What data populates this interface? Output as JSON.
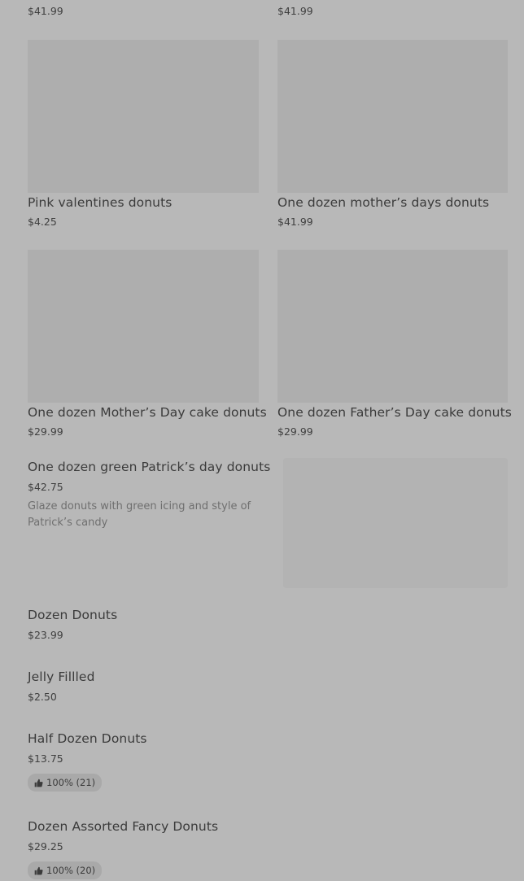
{
  "top_row": [
    {
      "price": "$41.99"
    },
    {
      "price": "$41.99"
    }
  ],
  "grid": [
    {
      "title": "Pink valentines donuts",
      "price": "$4.25"
    },
    {
      "title": "One dozen mother’s days donuts",
      "price": "$41.99"
    },
    {
      "title": "One dozen Mother’s Day cake donuts",
      "price": "$29.99"
    },
    {
      "title": "One dozen Father’s Day cake donuts",
      "price": "$29.99"
    }
  ],
  "featured": {
    "title": "One dozen green Patrick’s day donuts",
    "price": "$42.75",
    "description": "Glaze donuts with green icing and style of Patrick’s candy"
  },
  "list": [
    {
      "title": "Dozen Donuts",
      "price": "$23.99"
    },
    {
      "title": "Jelly Fillled",
      "price": "$2.50"
    },
    {
      "title": "Half Dozen Donuts",
      "price": "$13.75",
      "rating": "100% (21)"
    },
    {
      "title": "Dozen Assorted Fancy Donuts",
      "price": "$29.25",
      "rating": "100% (20)"
    }
  ],
  "icons": {
    "rating": "thumbs-up-icon"
  }
}
